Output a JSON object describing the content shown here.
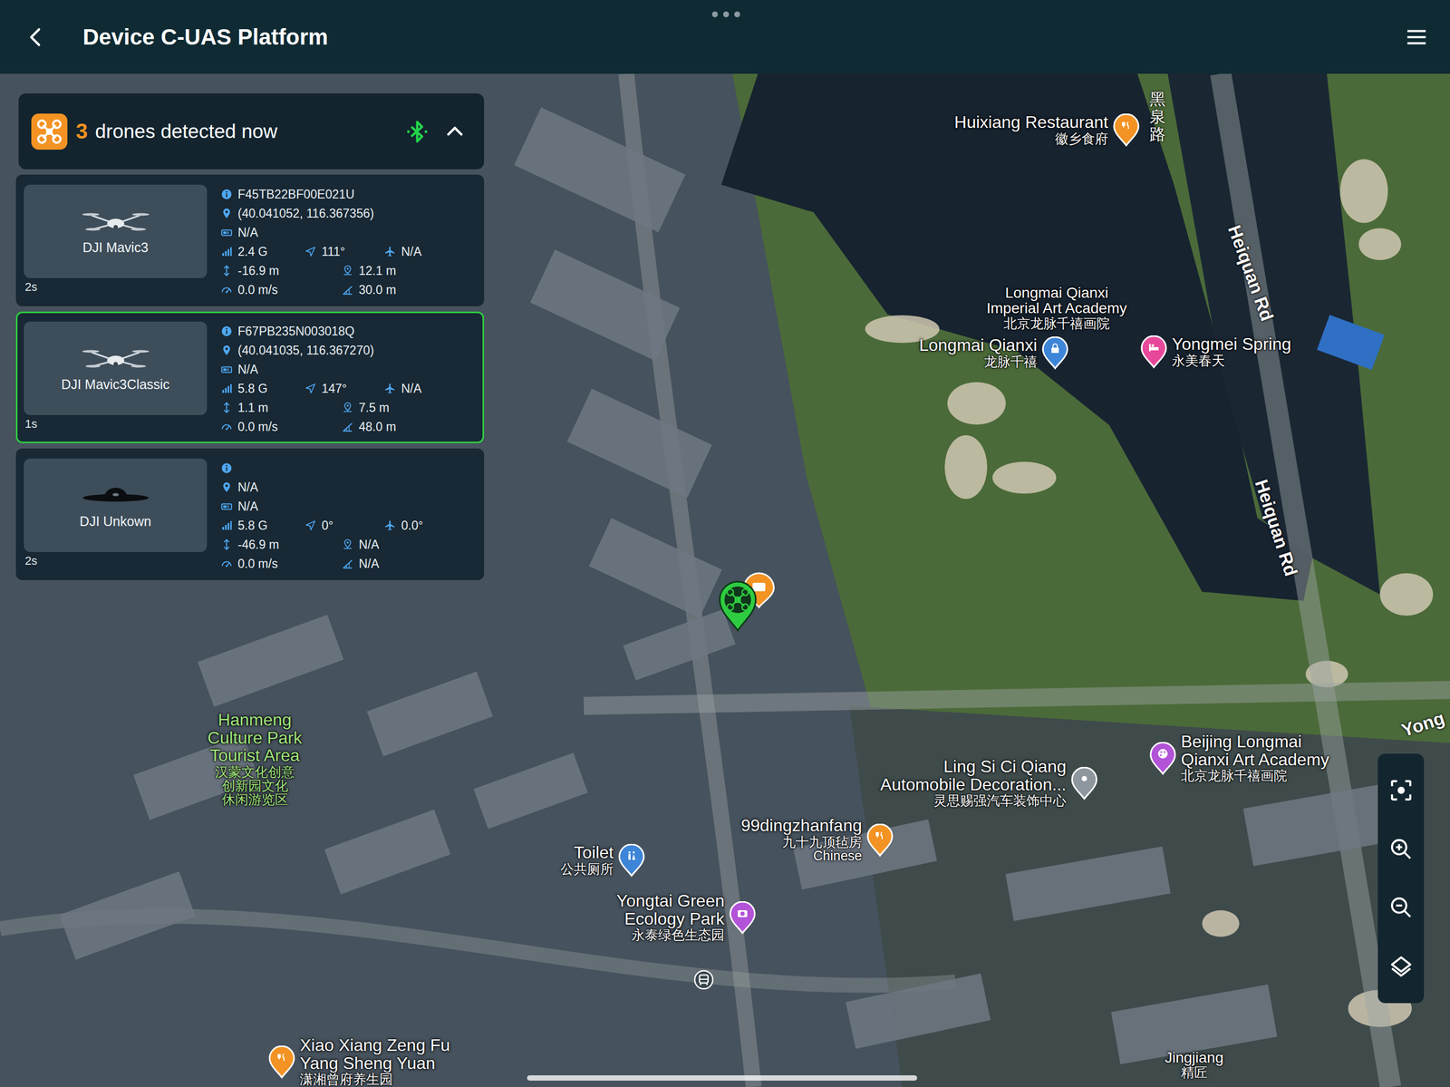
{
  "header": {
    "title": "Device C-UAS Platform"
  },
  "detection": {
    "count": "3",
    "label": "drones detected now",
    "bluetooth_connected": true,
    "expanded": true
  },
  "drones": [
    {
      "kind": "quadcopter",
      "model": "DJI Mavic3",
      "age": "2s",
      "selected": false,
      "id": "F45TB22BF00E021U",
      "position": "(40.041052, 116.367356)",
      "type": "N/A",
      "signal": "2.4 G",
      "heading": "111°",
      "flight": "N/A",
      "altitude": "-16.9 m",
      "distance": "12.1 m",
      "speed": "0.0 m/s",
      "height": "30.0 m"
    },
    {
      "kind": "quadcopter",
      "model": "DJI Mavic3Classic",
      "age": "1s",
      "selected": true,
      "id": "F67PB235N003018Q",
      "position": "(40.041035, 116.367270)",
      "type": "N/A",
      "signal": "5.8 G",
      "heading": "147°",
      "flight": "N/A",
      "altitude": "1.1 m",
      "distance": "7.5 m",
      "speed": "0.0 m/s",
      "height": "48.0 m"
    },
    {
      "kind": "unknown",
      "model": "DJI Unkown",
      "age": "2s",
      "selected": false,
      "id": "",
      "position": "N/A",
      "type": "N/A",
      "signal": "5.8 G",
      "heading": "0°",
      "flight": "0.0°",
      "altitude": "-46.9 m",
      "distance": "N/A",
      "speed": "0.0 m/s",
      "height": "N/A"
    }
  ],
  "map": {
    "pins": [
      {
        "kind": "restaurant",
        "color": "#f39323",
        "lines": [
          "Huixiang Restaurant",
          "徽乡食府"
        ]
      },
      {
        "kind": "lock",
        "color": "#3d85d8",
        "lines": [
          "Longmai Qianxi",
          "龙脉千禧"
        ]
      },
      {
        "kind": "hotel",
        "color": "#e8489a",
        "lines": [
          "Yongmei Spring",
          "永美春天"
        ]
      },
      {
        "kind": "art",
        "color": "#b253d8",
        "lines": [
          "Beijing Longmai",
          "Qianxi Art Academy",
          "北京龙脉千禧画院"
        ]
      },
      {
        "kind": "place",
        "color": "#8e979e",
        "lines": [
          "Ling Si Ci Qiang",
          "Automobile Decoration...",
          "灵思赐强汽车装饰中心"
        ]
      },
      {
        "kind": "restaurant",
        "color": "#f39323",
        "lines": [
          "99dingzhanfang",
          "九十九顶毡房"
        ],
        "note": "Chinese"
      },
      {
        "kind": "toilet",
        "color": "#3d85d8",
        "lines": [
          "Toilet",
          "公共厕所"
        ]
      },
      {
        "kind": "camera",
        "color": "#b253d8",
        "lines": [
          "Yongtai Green",
          "Ecology Park",
          "永泰绿色生态园"
        ]
      },
      {
        "kind": "restaurant",
        "color": "#f39323",
        "lines": [
          "Xiao Xiang Zeng Fu",
          "Yang Sheng Yuan",
          "潇湘曾府养生园"
        ]
      }
    ],
    "labels": [
      {
        "lines": [
          "Longmai Qianxi",
          "Imperial Art Academy",
          "北京龙脉千禧画院"
        ]
      },
      {
        "lines": [
          "Hanmeng",
          "Culture Park",
          "Tourist Area",
          "汉蒙文化创意",
          "创新园文化",
          "休闲游览区"
        ]
      },
      {
        "lines": [
          "Jingjiang",
          "精匠"
        ]
      }
    ],
    "roads": [
      "Heiquan Rd",
      "Heiquan Rd",
      "Yong",
      "黑泉路"
    ],
    "markers": [
      {
        "kind": "alert",
        "color": "#f39323"
      },
      {
        "kind": "drone",
        "color": "#2ecc40"
      }
    ]
  }
}
